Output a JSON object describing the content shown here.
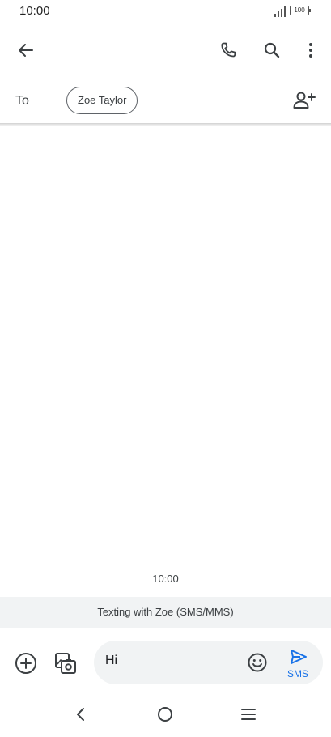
{
  "status_bar": {
    "time": "10:00",
    "battery": "100"
  },
  "app_bar": {
    "icons": [
      "arrow-back-icon",
      "phone-icon",
      "search-icon",
      "more-vert-icon"
    ]
  },
  "recipient": {
    "to_label": "To",
    "contact_chip": "Zoe Taylor"
  },
  "conversation": {
    "timestamp": "10:00",
    "banner": "Texting with Zoe (SMS/MMS)"
  },
  "compose": {
    "message_value": "Hi",
    "send_label": "SMS"
  },
  "colors": {
    "accent": "#1a73e8",
    "banner_bg": "#f1f3f4",
    "compose_bg": "#f1f3f4",
    "icon": "#3c4043"
  }
}
